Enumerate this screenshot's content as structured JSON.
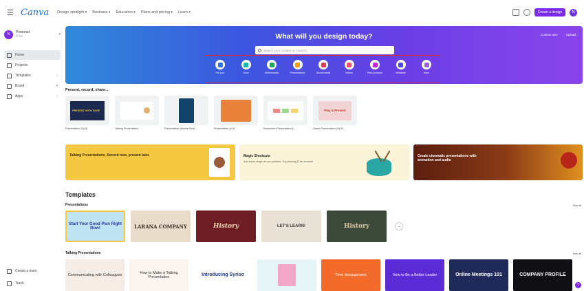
{
  "topbar": {
    "logo": "Canva",
    "nav": [
      "Design spotlight",
      "Business",
      "Education",
      "Plans and pricing",
      "Learn"
    ],
    "create_label": "Create a design",
    "avatar_initial": "N"
  },
  "sidebar": {
    "account_name": "Personal",
    "account_sub": "Free",
    "account_initial": "N",
    "items": [
      {
        "label": "Home",
        "icon": "home-icon"
      },
      {
        "label": "Projects",
        "icon": "folder-icon"
      },
      {
        "label": "Templates",
        "icon": "templates-icon"
      },
      {
        "label": "Brand",
        "icon": "brand-icon"
      },
      {
        "label": "Apps",
        "icon": "apps-icon"
      }
    ],
    "bottom": [
      {
        "label": "Create a team",
        "icon": "team-icon"
      },
      {
        "label": "Trash",
        "icon": "trash-icon"
      }
    ]
  },
  "hero": {
    "title": "What will you design today?",
    "custom_size": "Custom size",
    "upload": "Upload",
    "search_placeholder": "Search your content or Canva's",
    "categories": [
      {
        "label": "For you",
        "color": "#2b6fe0"
      },
      {
        "label": "Docs",
        "color": "#14b8a6"
      },
      {
        "label": "Whiteboards",
        "color": "#22a35a"
      },
      {
        "label": "Presentations",
        "color": "#f39c12"
      },
      {
        "label": "Social media",
        "color": "#e53950"
      },
      {
        "label": "Videos",
        "color": "#ee4f6e"
      },
      {
        "label": "Print products",
        "color": "#c026d3"
      },
      {
        "label": "Websites",
        "color": "#4f46e5"
      },
      {
        "label": "More",
        "color": "#9b5de5"
      }
    ]
  },
  "recent": {
    "title": "Present, record, share...",
    "items": [
      {
        "label": "Presentation (16:9)",
        "art": "PRESENT WITH EASE"
      },
      {
        "label": "Talking Presentation",
        "art": ""
      },
      {
        "label": "Presentation (Mobile-First)",
        "art": ""
      },
      {
        "label": "Presentation (4:3)",
        "art": ""
      },
      {
        "label": "Brainstorm Presentation (...",
        "art": ""
      },
      {
        "label": "Game Presentation (16:9)",
        "art": "Play & Present"
      }
    ]
  },
  "banners": [
    {
      "title": "Talking Presentations. Record now, present later.",
      "sub": ""
    },
    {
      "title": "Magic Shortcuts",
      "sub": "Add some magic as you present. Try pressing D for drumroll"
    },
    {
      "title": "Create cinematic presentations with animation and audio",
      "sub": ""
    }
  ],
  "templates": {
    "heading": "Templates",
    "presentations_title": "Presentations",
    "see_all": "See all",
    "presentations": [
      {
        "text": "Start Your Good Plan Right Now!",
        "bg": "#bfe3f2",
        "fg": "#1f3a93"
      },
      {
        "text": "LARANA COMPANY",
        "bg": "#e9dccb",
        "fg": "#3b2a20"
      },
      {
        "text": "History",
        "bg": "#6f1e26",
        "fg": "#f0d7b3"
      },
      {
        "text": "LET'S LEARN!",
        "bg": "#e8e1d6",
        "fg": "#3a3a3a"
      },
      {
        "text": "History",
        "bg": "#3d4a3a",
        "fg": "#d8c9a3"
      }
    ],
    "talking_title": "Talking Presentations",
    "talking": [
      {
        "text": "Communicating with Colleagues",
        "bg": "#f6ece6",
        "fg": "#2d2d2d"
      },
      {
        "text": "How to Make a Talking Presentation",
        "bg": "#fbf4ef",
        "fg": "#2d2d2d"
      },
      {
        "text": "Introducing Syriso",
        "bg": "#ffffff",
        "fg": "#1e3a8a"
      },
      {
        "text": "",
        "bg": "#e4f4f7",
        "fg": "#2d2d2d"
      },
      {
        "text": "Time Management",
        "bg": "#f26b2a",
        "fg": "#ffffff"
      },
      {
        "text": "How to Be a Better Leader",
        "bg": "#5b2cd6",
        "fg": "#ffffff"
      },
      {
        "text": "Online Meetings 101",
        "bg": "#1f2a5a",
        "fg": "#ffffff"
      },
      {
        "text": "COMPANY PROFILE",
        "bg": "#0f0f14",
        "fg": "#ffffff"
      }
    ]
  }
}
